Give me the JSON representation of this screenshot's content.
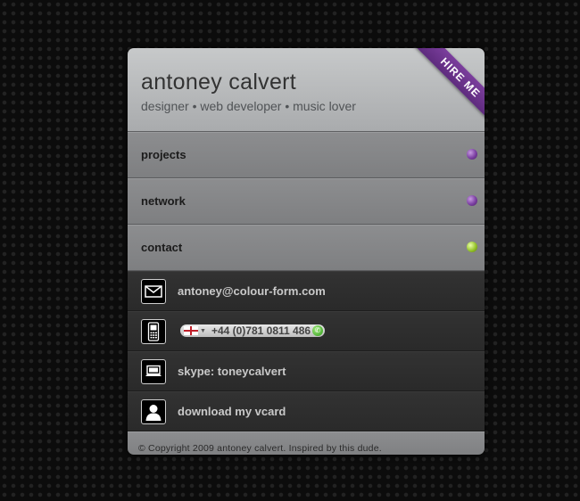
{
  "header": {
    "name": "antoney calvert",
    "tagline": "designer • web developer • music lover",
    "ribbon_label": "HIRE ME"
  },
  "nav": [
    {
      "label": "projects",
      "dot": "purple"
    },
    {
      "label": "network",
      "dot": "purple"
    },
    {
      "label": "contact",
      "dot": "green"
    }
  ],
  "contact": {
    "email": "antoney@colour-form.com",
    "phone": "+44 (0)781 0811 486",
    "skype": "skype: toneycalvert",
    "vcard": "download my vcard"
  },
  "footer": {
    "text": "© Copyright 2009 antoney calvert. Inspired by this",
    "link": "dude",
    "end": "."
  },
  "colors": {
    "accent_purple": "#7b3e9d",
    "accent_green": "#95c42a"
  }
}
